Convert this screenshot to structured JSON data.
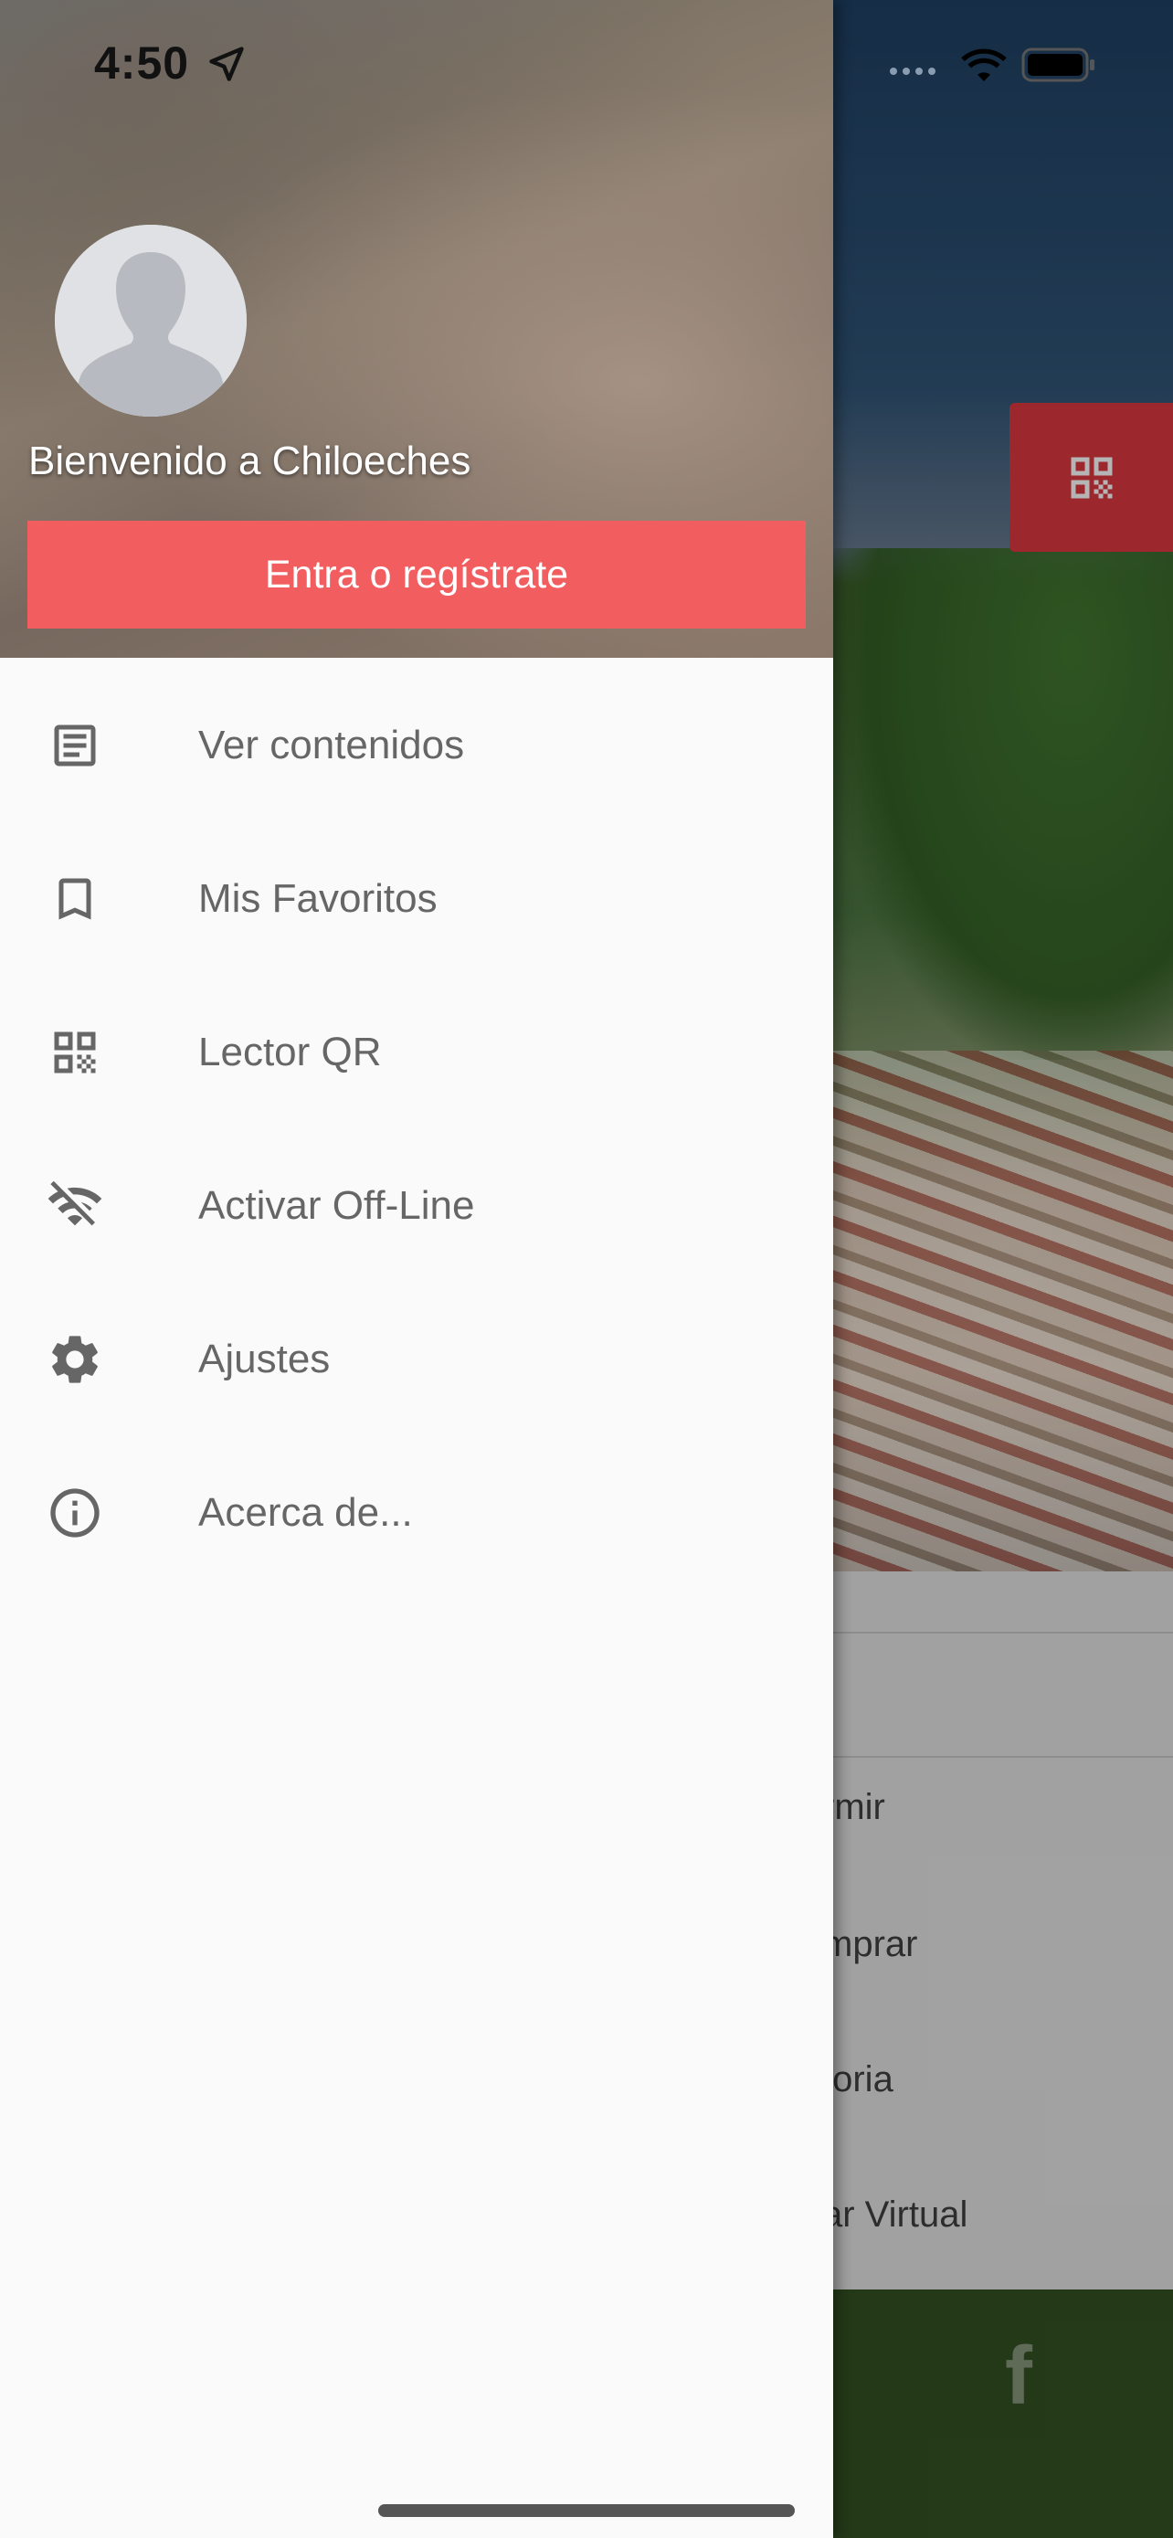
{
  "status_bar": {
    "time": "4:50"
  },
  "drawer": {
    "welcome": "Bienvenido a Chiloeches",
    "login_button": "Entra o regístrate",
    "menu": [
      {
        "label": "Ver contenidos",
        "icon": "article-icon"
      },
      {
        "label": "Mis Favoritos",
        "icon": "bookmark-icon"
      },
      {
        "label": "Lector QR",
        "icon": "qr-code-icon"
      },
      {
        "label": "Activar Off-Line",
        "icon": "wifi-off-icon"
      },
      {
        "label": "Ajustes",
        "icon": "gear-icon"
      },
      {
        "label": "Acerca de...",
        "icon": "info-icon"
      }
    ]
  },
  "background_app": {
    "list_items": [
      "rmir",
      "mprar",
      "toria",
      "ar Virtual"
    ],
    "footer_icon": "facebook-icon"
  },
  "colors": {
    "accent": "#f25e60",
    "qr_button": "#c8323a",
    "footer": "#2f4a1f",
    "menu_text": "#666666"
  }
}
